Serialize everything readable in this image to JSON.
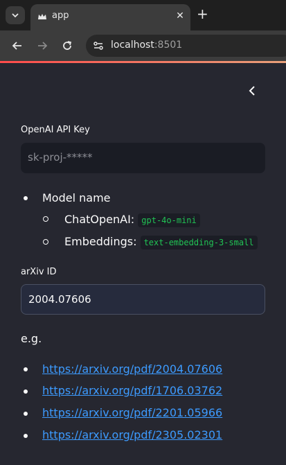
{
  "browser": {
    "tab_title": "app",
    "url_host": "localhost",
    "url_port": ":8501"
  },
  "sidebar": {
    "api_key_label": "OpenAI API Key",
    "api_key_placeholder": "sk-proj-*****",
    "model_heading": "Model name",
    "models": [
      {
        "label": "ChatOpenAI:",
        "value": "gpt-4o-mini"
      },
      {
        "label": "Embeddings:",
        "value": "text-embedding-3-small"
      }
    ],
    "arxiv_label": "arXiv ID",
    "arxiv_value": "2004.07606",
    "examples_label": "e.g.",
    "examples": [
      "https://arxiv.org/pdf/2004.07606",
      "https://arxiv.org/pdf/1706.03762",
      "https://arxiv.org/pdf/2201.05966",
      "https://arxiv.org/pdf/2305.02301"
    ]
  },
  "colors": {
    "background": "#262730",
    "link": "#3d9bff",
    "code": "#21c354",
    "accent": "#ff4b4b"
  }
}
